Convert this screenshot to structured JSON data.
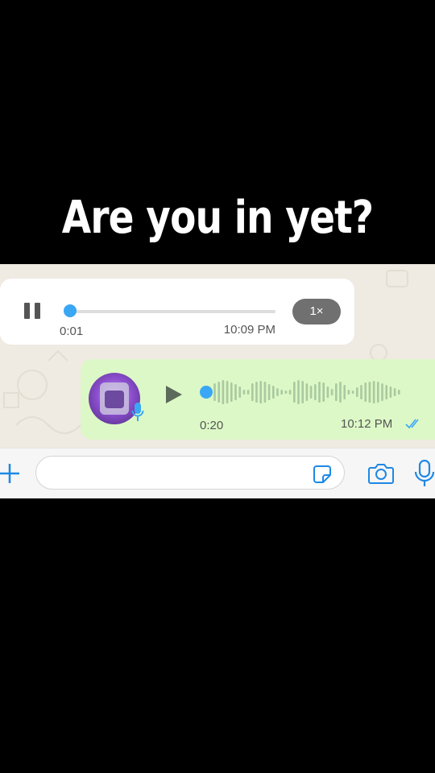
{
  "caption": "Are you in yet?",
  "incoming_voice": {
    "elapsed": "0:01",
    "sent_time": "10:09 PM",
    "speed": "1×",
    "progress": 0.0,
    "state": "playing"
  },
  "outgoing_voice": {
    "duration": "0:20",
    "sent_time": "10:12 PM",
    "status": "read",
    "progress": 0.0,
    "state": "paused"
  },
  "input_bar": {
    "placeholder": ""
  },
  "colors": {
    "accent": "#3aa7f5",
    "outgoing_bubble": "#dcf8c6",
    "incoming_bubble": "#ffffff",
    "chat_background": "#efeae2",
    "speed_pill": "#707070"
  },
  "icons": {
    "pause": "pause-icon",
    "play": "play-icon",
    "mic_badge": "microphone-icon",
    "read_ticks": "double-check-icon",
    "attach": "plus-icon",
    "sticker": "sticker-icon",
    "camera": "camera-icon",
    "mic": "microphone-icon"
  }
}
